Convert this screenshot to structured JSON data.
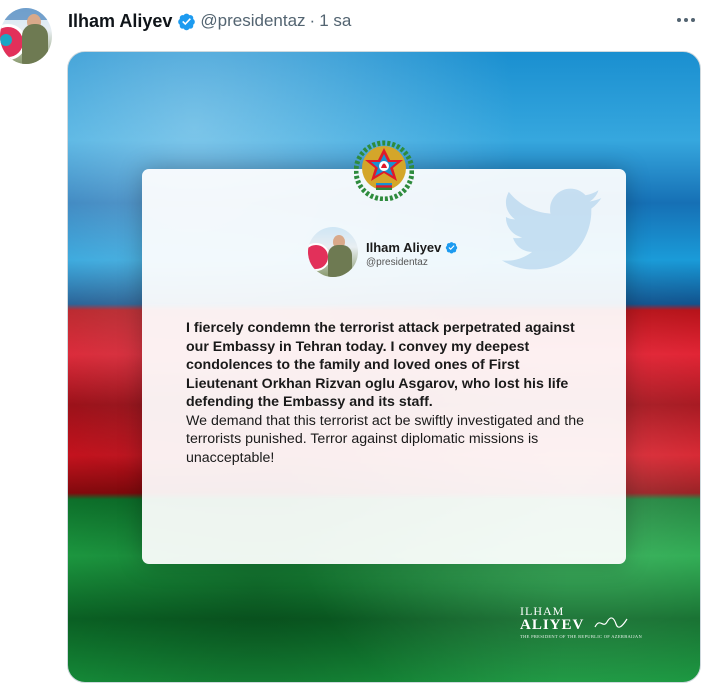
{
  "post": {
    "author_name": "Ilham Aliyev",
    "handle": "@presidentaz",
    "separator": "·",
    "time": "1 sa",
    "more_icon": "more-horizontal-icon",
    "verified_color": "#1d9bf0"
  },
  "image": {
    "card": {
      "author_name": "Ilham Aliyev",
      "handle": "@presidentaz",
      "text_bold": "I fiercely condemn the terrorist attack perpetrated against our Embassy in Tehran today. I convey my deepest condolences to the family and loved ones of First Lieutenant Orkhan Rizvan oglu Asgarov, who lost his life defending the Embassy and its staff.",
      "text_regular": "We demand that this terrorist act be swiftly investigated and the terrorists punished. Terror against diplomatic missions is unacceptable!"
    },
    "signature": {
      "first": "ILHAM",
      "last": "ALIYEV",
      "caption": "THE PRESIDENT OF THE REPUBLIC OF AZERBAIJAN"
    },
    "flag_colors": [
      "#1a9bd8",
      "#e0192a",
      "#1fa646"
    ]
  }
}
